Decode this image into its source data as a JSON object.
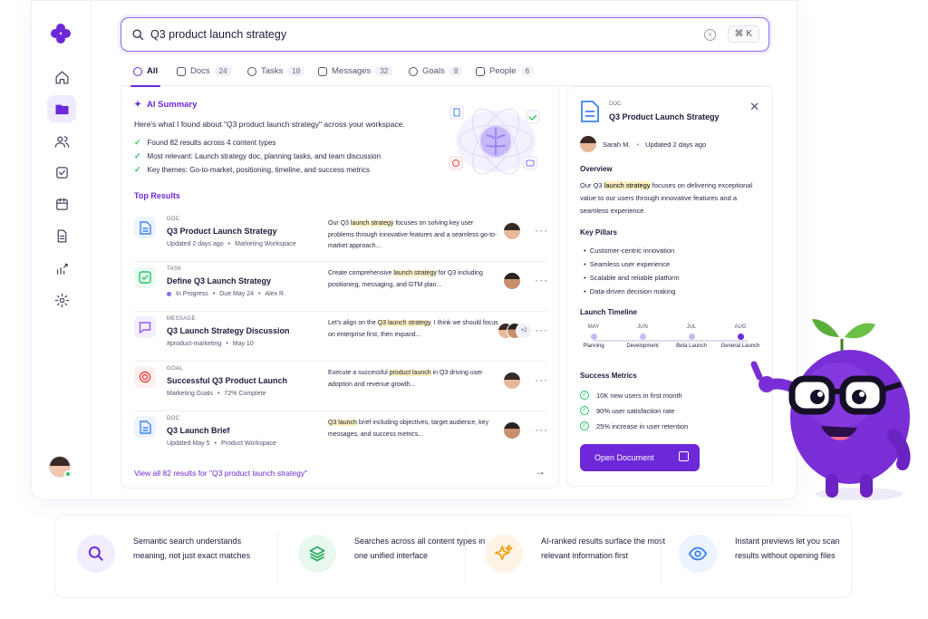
{
  "search": {
    "query": "Q3 product launch strategy",
    "shortcut": "⌘ K"
  },
  "tabs": [
    {
      "label": "All",
      "count": ""
    },
    {
      "label": "Docs",
      "count": "24"
    },
    {
      "label": "Tasks",
      "count": "18"
    },
    {
      "label": "Messages",
      "count": "32"
    },
    {
      "label": "Goals",
      "count": "8"
    },
    {
      "label": "People",
      "count": "6"
    }
  ],
  "ai": {
    "title": "AI Summary",
    "intro": "Here's what I found about \"Q3 product launch strategy\" across your workspace.",
    "bullets": [
      "Found 82 results across 4 content types",
      "Most relevant: Launch strategy doc, planning tasks, and team discussion",
      "Key themes: Go-to-market, positioning, timeline, and success metrics"
    ]
  },
  "top_results_label": "Top Results",
  "results": [
    {
      "type": "DOC",
      "title": "Q3 Product Launch Strategy",
      "meta1": "Updated 2 days ago",
      "meta2": "Marketing Workspace",
      "snip_pre": "Our Q3 ",
      "snip_hl": "launch strategy",
      "snip_post": " focuses on solving key user problems through innovative features and a seamless go-to-market approach..."
    },
    {
      "type": "TASK",
      "title": "Define Q3 Launch Strategy",
      "meta1": "In Progress",
      "meta2": "Due May 24",
      "meta3": "Alex R.",
      "snip_pre": "Create comprehensive ",
      "snip_hl": "launch strategy",
      "snip_post": " for Q3 including positioning, messaging, and GTM plan..."
    },
    {
      "type": "MESSAGE",
      "title": "Q3 Launch Strategy Discussion",
      "meta1": "#product-marketing",
      "meta2": "May 10",
      "snip_pre": "Let's align on the ",
      "snip_hl": "Q3 launch strategy",
      "snip_post": ". I think we should focus on enterprise first, then expand...",
      "extra": "+2"
    },
    {
      "type": "GOAL",
      "title": "Successful Q3 Product Launch",
      "meta1": "Marketing Goals",
      "meta2": "72% Complete",
      "snip_pre": "Execute a successful ",
      "snip_hl": "product launch",
      "snip_post": " in Q3 driving user adoption and revenue growth..."
    },
    {
      "type": "DOC",
      "title": "Q3 Launch Brief",
      "meta1": "Updated May 5",
      "meta2": "Product Workspace",
      "snip_pre": "",
      "snip_hl": "Q3 launch",
      "snip_post": " brief including objectives, target audience, key messages, and success metrics..."
    }
  ],
  "view_all": "View all 82 results for  \"Q3 product launch strategy\"",
  "preview": {
    "type": "DOC",
    "title": "Q3 Product Launch Strategy",
    "author": "Sarah M.",
    "updated": "Updated 2 days ago",
    "overview_h": "Overview",
    "overview_pre": "Our Q3 ",
    "overview_hl": "launch strategy",
    "overview_post": " focuses on delivering exceptional value to our users through innovative features and a seamless experience.",
    "pillars_h": "Key Pillars",
    "pillars": [
      "Customer-centric innovation",
      "Seamless user experience",
      "Scalable and reliable platform",
      "Data-driven decision making"
    ],
    "timeline_h": "Launch Timeline",
    "timeline": [
      {
        "month": "MAY",
        "label": "Planning"
      },
      {
        "month": "JUN",
        "label": "Development"
      },
      {
        "month": "JUL",
        "label": "Beta Launch"
      },
      {
        "month": "AUG",
        "label": "General Launch"
      }
    ],
    "metrics_h": "Success Metrics",
    "metrics": [
      "10K new users in first month",
      "90% user satisfaction rate",
      "25% increase in user retention"
    ],
    "open_label": "Open Document"
  },
  "features": [
    {
      "text": "Semantic search understands meaning, not just exact matches",
      "icon": "search-icon"
    },
    {
      "text": "Searches across all content types in one unified interface",
      "icon": "layers-icon"
    },
    {
      "text": "AI-ranked results surface the most relevant information first",
      "icon": "sparkle-icon"
    },
    {
      "text": "Instant previews let you scan results without opening files",
      "icon": "eye-icon"
    }
  ],
  "colors": {
    "accent": "#6d28d9",
    "highlight": "#fdf1bf",
    "success": "#22c55e"
  }
}
